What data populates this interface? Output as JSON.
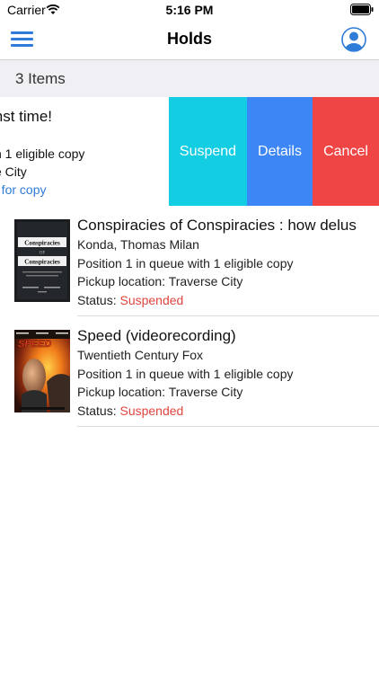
{
  "status_bar": {
    "carrier": "Carrier",
    "time": "5:16 PM"
  },
  "nav": {
    "title": "Holds",
    "icons": {
      "menu": "hamburger-menu-icon",
      "profile": "user-profile-icon"
    },
    "accent_color": "#2f7bd8"
  },
  "section": {
    "header": "3 Items"
  },
  "swiped_hold": {
    "title_fragment": "inst time!",
    "queue_fragment": "n 1 eligible copy",
    "pickup_fragment": "e City",
    "status_fragment": "g for copy",
    "actions": [
      {
        "label": "Suspend",
        "color": "#13cde2"
      },
      {
        "label": "Details",
        "color": "#3d86f6"
      },
      {
        "label": "Cancel",
        "color": "#ef4545"
      }
    ]
  },
  "holds": [
    {
      "title": "Conspiracies of Conspiracies : how delus",
      "author": "Konda, Thomas Milan",
      "queue": "Position 1 in queue with 1 eligible copy",
      "pickup": "Pickup location: Traverse City",
      "status_label": "Status:",
      "status_value": "Suspended",
      "cover": {
        "line1": "Conspiracies",
        "line2": "OF",
        "line3": "Conspiracies"
      }
    },
    {
      "title": "Speed (videorecording)",
      "author": "Twentieth Century Fox",
      "queue": "Position 1 in queue with 1 eligible copy",
      "pickup": "Pickup location: Traverse City",
      "status_label": "Status:",
      "status_value": "Suspended",
      "cover": {
        "logo": "SPEED"
      }
    }
  ],
  "colors": {
    "status_suspended": "#e0443e",
    "section_bg": "#efeff4"
  }
}
